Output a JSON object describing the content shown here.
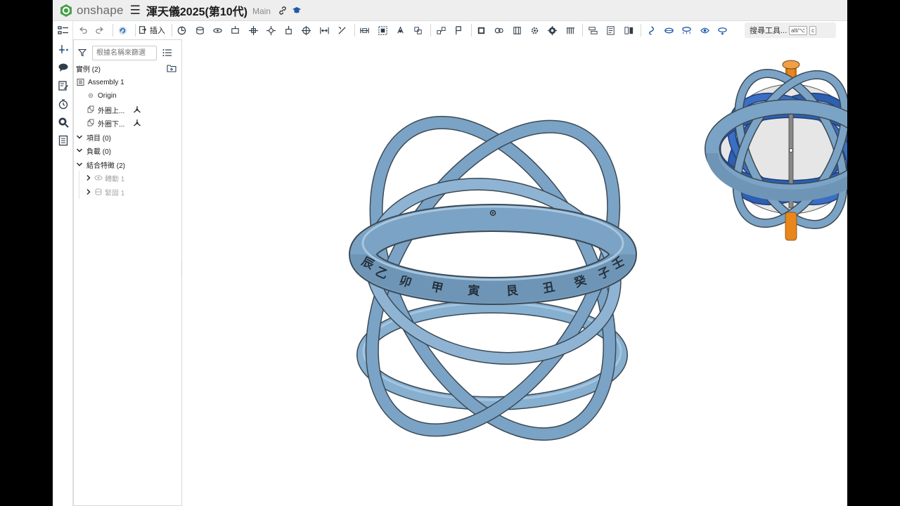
{
  "app": {
    "brand": "onshape",
    "document_title": "渾天儀2025(第10代)",
    "branch": "Main"
  },
  "toolbar": {
    "insert_label": "插入",
    "search_label": "搜尋工具...",
    "shortcut_1": "alt/⌥",
    "shortcut_2": "c",
    "tools": [
      "fasten-mate-icon",
      "revolute-mate-icon",
      "slider-mate-icon",
      "planar-mate-icon",
      "cylindrical-mate-icon",
      "pin-slot-mate-icon",
      "ball-mate-icon",
      "parallel-mate-icon",
      "tangent-mate-icon",
      "width-mate-icon",
      "group-icon",
      "mate-connector-icon",
      "replicate-icon",
      "pattern-icon",
      "fix-icon",
      "snapshot-icon",
      "gear-relation-icon",
      "rack-pinion-icon",
      "screw-relation-icon",
      "linear-relation-icon",
      "cam-icon",
      "mate-values-icon",
      "exploded-view-icon",
      "named-positions-icon",
      "rotate-view-icon",
      "section-view-icon",
      "display-states-icon",
      "view-cube-icon",
      "measure-icon",
      "animate-icon"
    ]
  },
  "panel": {
    "filter_placeholder": "根據名稱來篩選",
    "instances_label": "實例 (2)",
    "assembly_label": "Assembly 1",
    "origin_label": "Origin",
    "instance_1": "外圈上...",
    "instance_2": "外圈下...",
    "items_label": "項目 (0)",
    "loads_label": "負載 (0)",
    "mate_features_label": "結合特徵 (2)",
    "mate_1": "轉動 1",
    "mate_2": "緊固 1"
  },
  "viewport": {
    "ring_glyphs": [
      "辰",
      "乙",
      "卯",
      "甲",
      "寅",
      "艮",
      "丑",
      "癸",
      "子",
      "壬"
    ],
    "accent_color": "#7ba3c6",
    "inner_color": "#2e5fb0",
    "axle_color": "#e8861c"
  },
  "colors": {
    "brand_green": "#46a04b",
    "toolbar_icon": "#2f3d4a",
    "active_blue": "#1e5aa8"
  }
}
